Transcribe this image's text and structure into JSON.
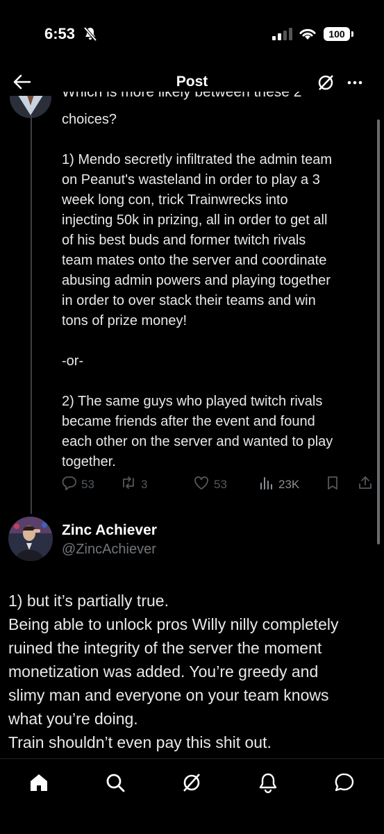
{
  "status": {
    "time": "6:53",
    "battery": "100"
  },
  "header": {
    "title": "Post"
  },
  "post": {
    "cutoff_text": "Which is more likely between these 2",
    "lines": [
      "choices?",
      "",
      "1) Mendo secretly infiltrated the admin team",
      "on Peanut's wasteland in order to play a 3",
      "week long con, trick Trainwrecks into",
      "injecting 50k in prizing, all in order to get all",
      "of his best buds and former twitch rivals",
      "team mates onto the server and coordinate",
      "abusing admin powers and playing together",
      "in order to over stack their teams and win",
      "tons of prize money!",
      "",
      "-or-",
      "",
      "2) The same guys who played twitch rivals",
      "became friends after the event and found",
      "each other on the server and wanted to play",
      "together."
    ],
    "metrics": {
      "replies": "53",
      "reposts": "3",
      "likes": "53",
      "views": "23K"
    }
  },
  "reply": {
    "name": "Zinc Achiever",
    "handle": "@ZincAchiever",
    "lines": [
      "1) but it’s partially true.",
      "Being able to unlock pros Willy nilly completely",
      "ruined the integrity of the server the moment",
      "monetization was added. You’re greedy and",
      "slimy man and everyone on your team knows",
      "what you’re doing.",
      "Train shouldn’t even pay this shit out."
    ]
  },
  "icons": [
    "bell-slash-icon",
    "signal-icon",
    "wifi-icon",
    "back-arrow-icon",
    "grok-icon",
    "more-icon",
    "reply-icon",
    "repost-icon",
    "like-icon",
    "views-icon",
    "bookmark-icon",
    "share-icon",
    "home-icon",
    "search-icon",
    "notifications-icon",
    "messages-icon"
  ]
}
